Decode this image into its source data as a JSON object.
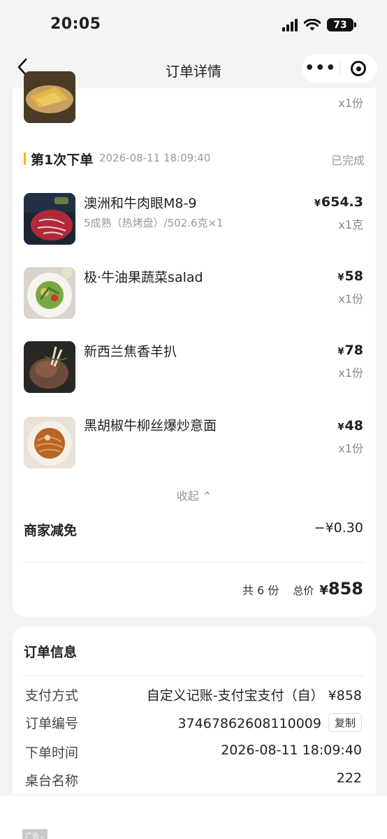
{
  "status_bar": {
    "time": "20:05",
    "battery": "73"
  },
  "nav": {
    "title": "订单详情",
    "more": "•••"
  },
  "top_item": {
    "qty": "x1份"
  },
  "order_section": {
    "label": "第1次下单",
    "time": "2026-08-11 18:09:40",
    "status": "已完成",
    "currency": "¥",
    "items": [
      {
        "name": "澳洲和牛肉眼M8-9",
        "spec": "5成熟（热烤盘）/502.6克×1",
        "price": "654.3",
        "qty": "x1克",
        "image": "steak-photo"
      },
      {
        "name": "极·牛油果蔬菜salad",
        "spec": "",
        "price": "58",
        "qty": "x1份",
        "image": "salad-photo"
      },
      {
        "name": "新西兰焦香羊扒",
        "spec": "",
        "price": "78",
        "qty": "x1份",
        "image": "lamb-chop-photo"
      },
      {
        "name": "黑胡椒牛柳丝爆炒意面",
        "spec": "",
        "price": "48",
        "qty": "x1份",
        "image": "pasta-photo"
      }
    ],
    "collapse_label": "收起 ⌃"
  },
  "discount": {
    "label": "商家减免",
    "value": "−¥0.30"
  },
  "totals": {
    "count_label": "共 6 份",
    "total_label": "总价",
    "currency": "¥",
    "total_value": "858"
  },
  "order_info": {
    "title": "订单信息",
    "rows": [
      {
        "key": "支付方式",
        "value": "自定义记账-支付宝支付（自） ¥858"
      },
      {
        "key": "订单编号",
        "value": "37467862608110009",
        "action": "复制"
      },
      {
        "key": "下单时间",
        "value": "2026-08-11 18:09:40"
      },
      {
        "key": "桌台名称",
        "value": "222"
      }
    ]
  },
  "ad": {
    "tag": "广告⌄"
  },
  "colors": {
    "accent": "#f5b800",
    "muted": "#999999",
    "background": "#f4f4f4"
  }
}
